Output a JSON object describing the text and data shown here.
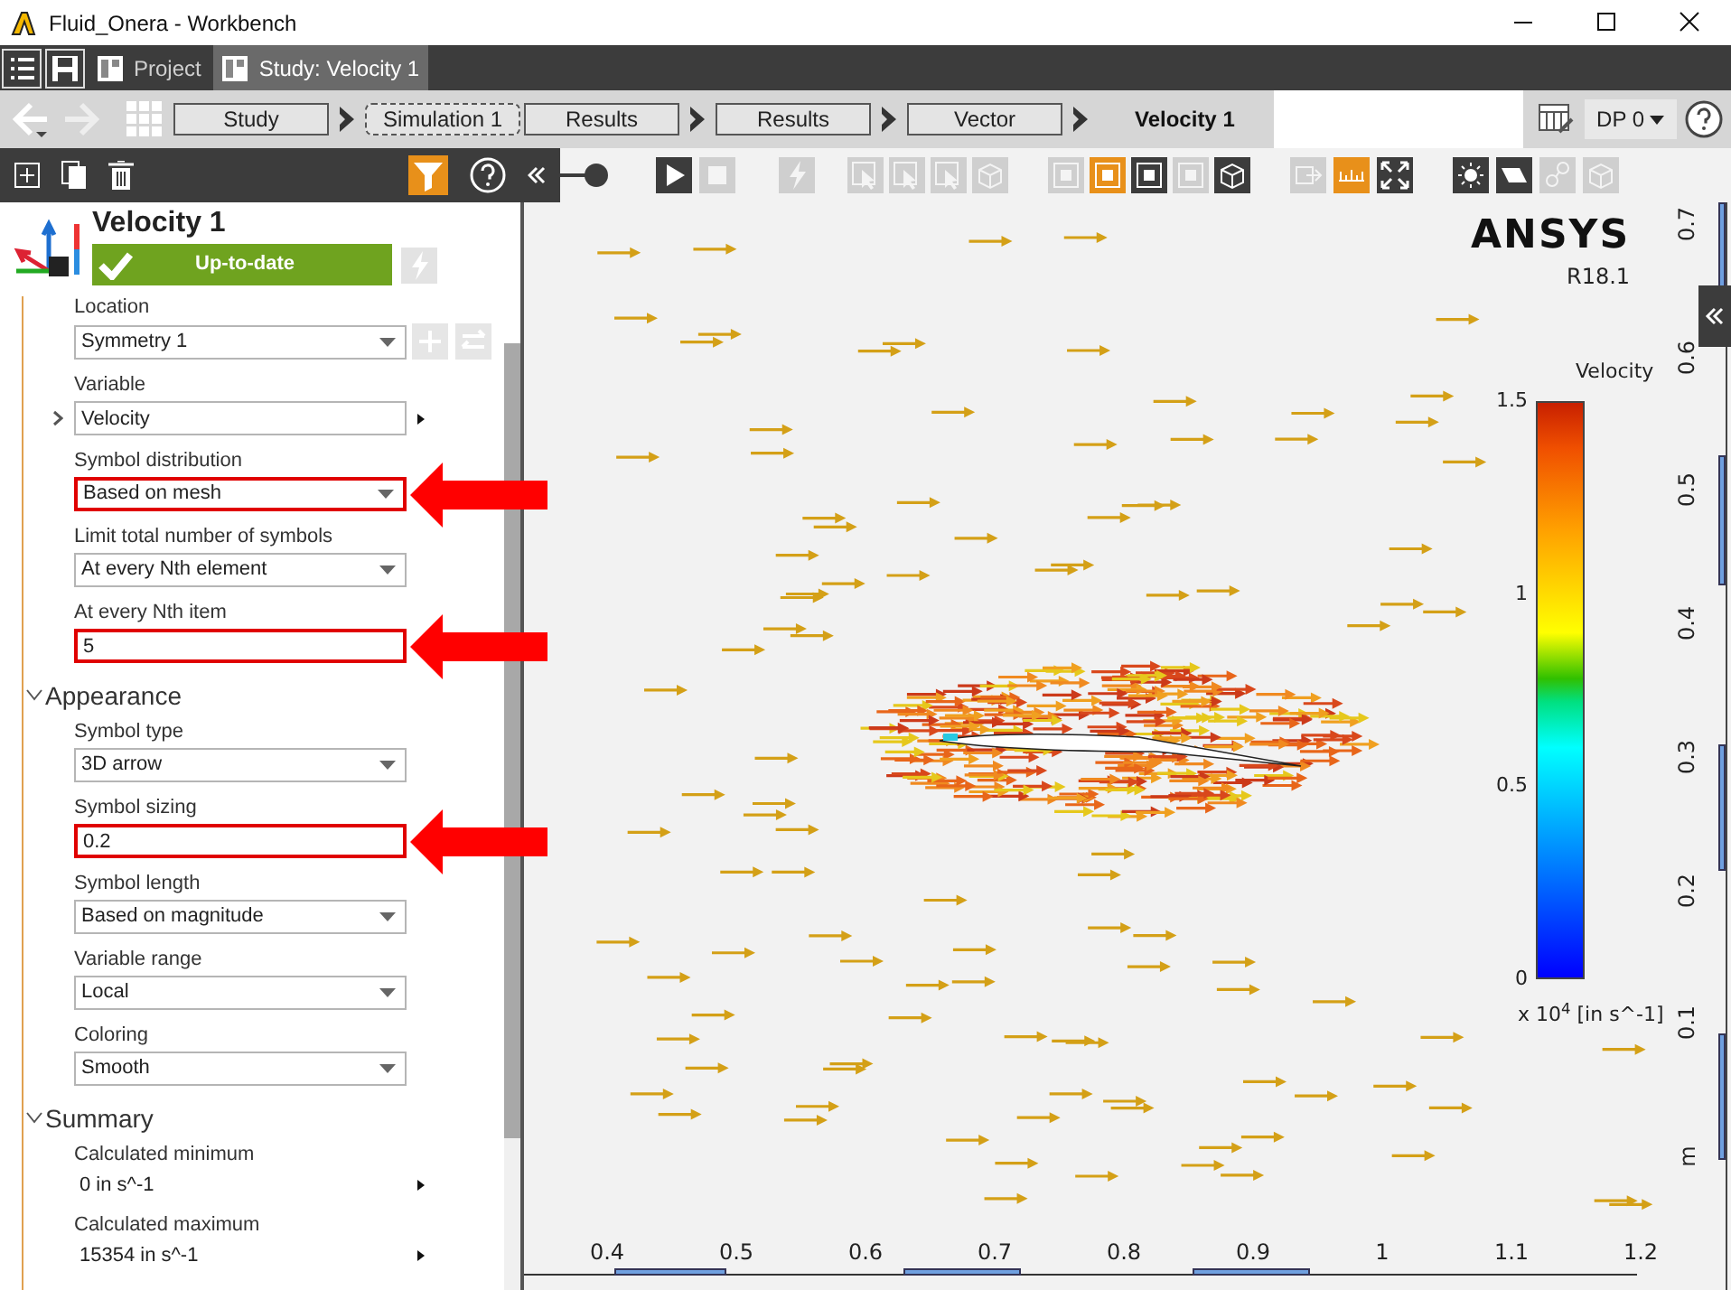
{
  "window": {
    "title": "Fluid_Onera - Workbench"
  },
  "tabs": [
    {
      "label": "Project",
      "selected": false
    },
    {
      "label": "Study: Velocity 1",
      "selected": true
    }
  ],
  "breadcrumb": [
    {
      "label": "Study",
      "kind": "solid",
      "arrow_after": true
    },
    {
      "label": "Simulation 1",
      "kind": "dashed",
      "arrow_after": false
    },
    {
      "label": "Results",
      "kind": "solid",
      "arrow_after": true
    },
    {
      "label": "Results",
      "kind": "solid",
      "arrow_after": true
    },
    {
      "label": "Vector",
      "kind": "solid",
      "arrow_after": true
    },
    {
      "label": "Velocity 1",
      "kind": "current",
      "arrow_after": false
    }
  ],
  "design_point": {
    "label": "DP 0"
  },
  "toolbar": [
    {
      "kind": "play",
      "active": false,
      "disabled": false
    },
    {
      "kind": "stop",
      "active": false,
      "disabled": true
    },
    {
      "kind": "bolt",
      "active": false,
      "disabled": true
    },
    {
      "kind": "select",
      "active": false,
      "disabled": true
    },
    {
      "kind": "select",
      "active": false,
      "disabled": true
    },
    {
      "kind": "select",
      "active": false,
      "disabled": true
    },
    {
      "kind": "cube",
      "active": false,
      "disabled": true
    },
    {
      "kind": "frame",
      "active": false,
      "disabled": true
    },
    {
      "kind": "frame",
      "active": true,
      "disabled": false
    },
    {
      "kind": "frame",
      "active": false,
      "disabled": false
    },
    {
      "kind": "frame",
      "active": false,
      "disabled": true
    },
    {
      "kind": "cube",
      "active": false,
      "disabled": false
    },
    {
      "kind": "export",
      "active": false,
      "disabled": true
    },
    {
      "kind": "ruler",
      "active": true,
      "disabled": false
    },
    {
      "kind": "fit",
      "active": false,
      "disabled": false
    },
    {
      "kind": "light",
      "active": false,
      "disabled": false
    },
    {
      "kind": "plane",
      "active": false,
      "disabled": false
    },
    {
      "kind": "link",
      "active": false,
      "disabled": true
    },
    {
      "kind": "cube",
      "active": false,
      "disabled": true
    }
  ],
  "panel": {
    "title": "Velocity 1",
    "status": "Up-to-date",
    "sections": [
      {
        "fields": [
          {
            "label": "Location",
            "kind": "select",
            "value": "Symmetry 1",
            "highlighted": false,
            "side_buttons": true
          },
          {
            "label": "Variable",
            "kind": "input",
            "value": "Velocity",
            "highlighted": false,
            "expander": true
          },
          {
            "label": "Symbol distribution",
            "kind": "select",
            "value": "Based on mesh",
            "highlighted": true
          },
          {
            "label": "Limit total number of symbols",
            "kind": "select",
            "value": "At every Nth element",
            "highlighted": false
          },
          {
            "label": "At every Nth item",
            "kind": "input",
            "value": "5",
            "highlighted": true
          }
        ]
      },
      {
        "title": "Appearance",
        "expanded": true,
        "fields": [
          {
            "label": "Symbol type",
            "kind": "select",
            "value": "3D arrow",
            "highlighted": false
          },
          {
            "label": "Symbol sizing",
            "kind": "input",
            "value": "0.2",
            "highlighted": true
          },
          {
            "label": "Symbol length",
            "kind": "select",
            "value": "Based on magnitude",
            "highlighted": false
          },
          {
            "label": "Variable range",
            "kind": "select",
            "value": "Local",
            "highlighted": false
          },
          {
            "label": "Coloring",
            "kind": "select",
            "value": "Smooth",
            "highlighted": false
          }
        ]
      },
      {
        "title": "Summary",
        "expanded": true,
        "fields": [
          {
            "label": "Calculated minimum",
            "kind": "value",
            "value": "0 in s^-1",
            "highlighted": false
          },
          {
            "label": "Calculated maximum",
            "kind": "value",
            "value": "15354 in s^-1",
            "highlighted": false
          }
        ]
      }
    ]
  },
  "viewport": {
    "logo": {
      "brand": "ANSYS",
      "version": "R18.1"
    },
    "legend": {
      "title": "Velocity",
      "ticks": [
        "1.5",
        "1",
        "0.5",
        "0"
      ],
      "unit": "x 10$^{4}$ [in s^-1]"
    },
    "x_axis": [
      "0.4",
      "0.5",
      "0.6",
      "0.7",
      "0.8",
      "0.9",
      "1",
      "1.1",
      "1.2"
    ],
    "y_axis": [
      "0.7",
      "0.6",
      "0.5",
      "0.4",
      "0.3",
      "0.2",
      "0.1",
      "m"
    ]
  }
}
